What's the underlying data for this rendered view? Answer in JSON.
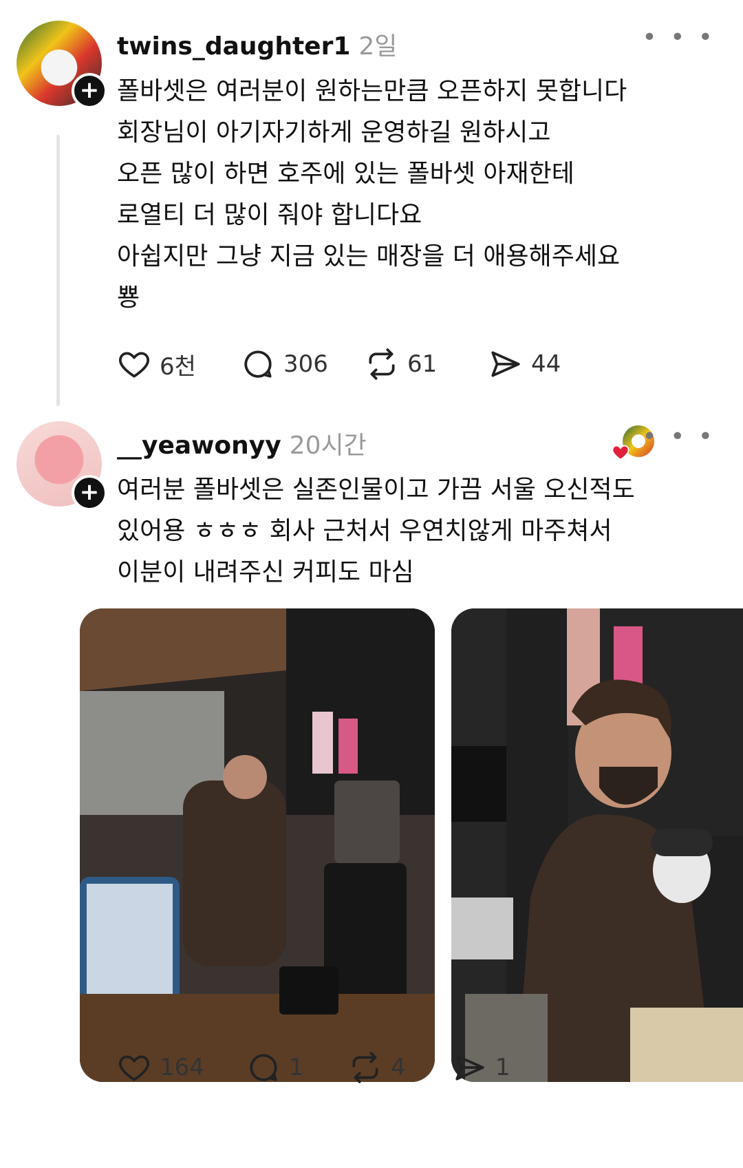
{
  "posts": [
    {
      "username": "twins_daughter1",
      "time": "2일",
      "text_lines": [
        "폴바셋은 여러분이 원하는만큼 오픈하지 못합니다",
        "회장님이 아기자기하게 운영하길 원하시고",
        "오픈 많이 하면 호주에 있는 폴바셋 아재한테",
        "로열티 더 많이 줘야 합니다요",
        "아쉽지만 그냥 지금 있는 매장을 더 애용해주세요",
        "뿅"
      ],
      "likes": "6천",
      "comments": "306",
      "reposts": "61",
      "shares": "44"
    },
    {
      "username": "__yeawonyy",
      "time": "20시간",
      "text_lines": [
        "여러분 폴바셋은 실존인물이고 가끔 서울 오신적도",
        "있어용 ㅎㅎㅎ 회사 근처서 우연치않게 마주쳐서",
        "이분이 내려주신 커피도 마심"
      ],
      "likes": "164",
      "comments": "1",
      "reposts": "4",
      "shares": "1"
    }
  ],
  "icons": {
    "more": "more-horizontal-icon",
    "like": "heart-icon",
    "comment": "comment-bubble-icon",
    "repost": "repost-icon",
    "share": "send-icon",
    "follow": "plus-icon"
  },
  "colors": {
    "text": "#111111",
    "muted": "#9a9a9a",
    "heart_badge": "#e0213a"
  }
}
